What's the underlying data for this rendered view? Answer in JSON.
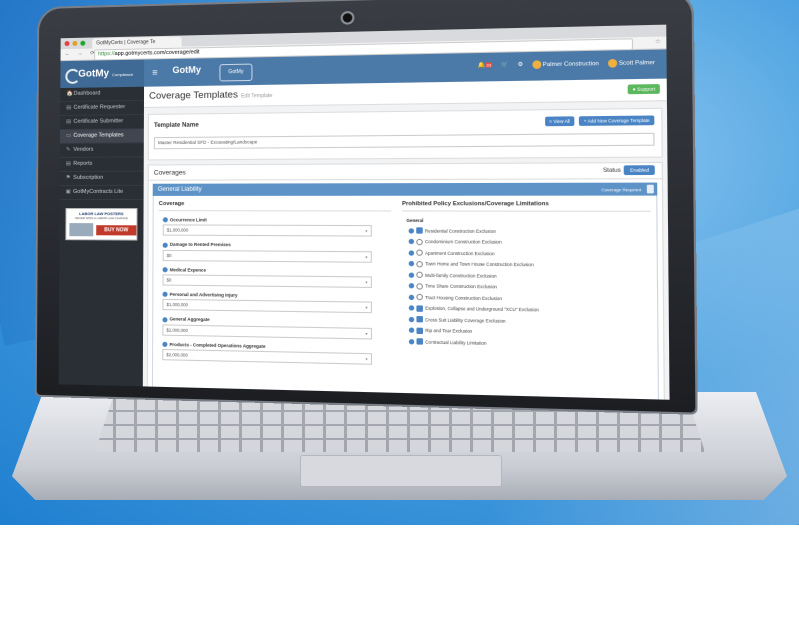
{
  "browser": {
    "tab_title": "GotMyCerts | Coverage Te",
    "url_https": "https://",
    "url_rest": "app.gotmycerts.com/coverage/edit"
  },
  "header": {
    "brand": "GotMy",
    "brand_sub": "Compliance Simplified",
    "logo2": "GotMy",
    "logo3": "GotMy",
    "notifications_count": "33",
    "company": "Palmer Construction",
    "user": "Scott Palmer"
  },
  "sidebar": {
    "items": [
      {
        "label": "Dashboard",
        "icon": "🏠"
      },
      {
        "label": "Certificate Requester",
        "icon": "▤"
      },
      {
        "label": "Certificate Submitter",
        "icon": "▤"
      },
      {
        "label": "Coverage Templates",
        "icon": "▭"
      },
      {
        "label": "Vendors",
        "icon": "✎"
      },
      {
        "label": "Reports",
        "icon": "▤"
      },
      {
        "label": "Subscription",
        "icon": "⚑"
      },
      {
        "label": "GotMyContracts Lite",
        "icon": "▣"
      }
    ],
    "ad": {
      "title": "LABOR LAW POSTERS",
      "sub": "NEVER MISS A LABOR LAW CHANGE",
      "button": "BUY NOW"
    }
  },
  "page": {
    "title": "Coverage Templates",
    "subtitle": "Edit Template",
    "support": "Support",
    "template_name_label": "Template Name",
    "view_all": "View All",
    "add_new": "Add New Coverage Template",
    "template_name_value": "Master Residential SFD - Excavating/Landscape",
    "coverages_label": "Coverages",
    "status_label": "Status",
    "status_value": "Enabled",
    "section_title": "General Liability",
    "coverage_required": "Coverage Required",
    "coverage_col_title": "Coverage",
    "exclusions_col_title": "Prohibited Policy Exclusions/Coverage Limitations",
    "general_label": "General"
  },
  "coverage_fields": [
    {
      "label": "Occurrence Limit",
      "value": "$1,000,000"
    },
    {
      "label": "Damage to Rented Premises",
      "value": "$0"
    },
    {
      "label": "Medical Expence",
      "value": "$0"
    },
    {
      "label": "Personal and Advertising Injury",
      "value": "$1,000,000"
    },
    {
      "label": "General Aggregate",
      "value": "$2,000,000"
    },
    {
      "label": "Products - Completed Operations Aggregate",
      "value": "$2,000,000"
    }
  ],
  "exclusions": [
    {
      "label": "Residential Construction Exclusion",
      "type": "checkbox",
      "checked": true
    },
    {
      "label": "Condominium Construction Exclusion",
      "type": "radio",
      "checked": false
    },
    {
      "label": "Apartment Construction Exclusion",
      "type": "radio",
      "checked": false
    },
    {
      "label": "Town Home and Town House Construction Exclusion",
      "type": "radio",
      "checked": false
    },
    {
      "label": "Multi-family Construction Exclusion",
      "type": "radio",
      "checked": false
    },
    {
      "label": "Time Share Construction Exclusion",
      "type": "radio",
      "checked": false
    },
    {
      "label": "Tract Housing Construction Exclusion",
      "type": "radio",
      "checked": false
    },
    {
      "label": "Explosion, Collapse and Underground \"XCU\" Exclusion",
      "type": "checkbox",
      "checked": true
    },
    {
      "label": "Cross Suit Liability Coverage Exclusion",
      "type": "checkbox",
      "checked": true
    },
    {
      "label": "Rip and Tear Exclusion",
      "type": "checkbox",
      "checked": true
    },
    {
      "label": "Contractual Liability Limitation",
      "type": "checkbox",
      "checked": true
    }
  ],
  "colors": {
    "header": "#4c7aa8",
    "sidebar": "#2a2e35",
    "accent": "#4a84c4",
    "support": "#5cb85c"
  }
}
